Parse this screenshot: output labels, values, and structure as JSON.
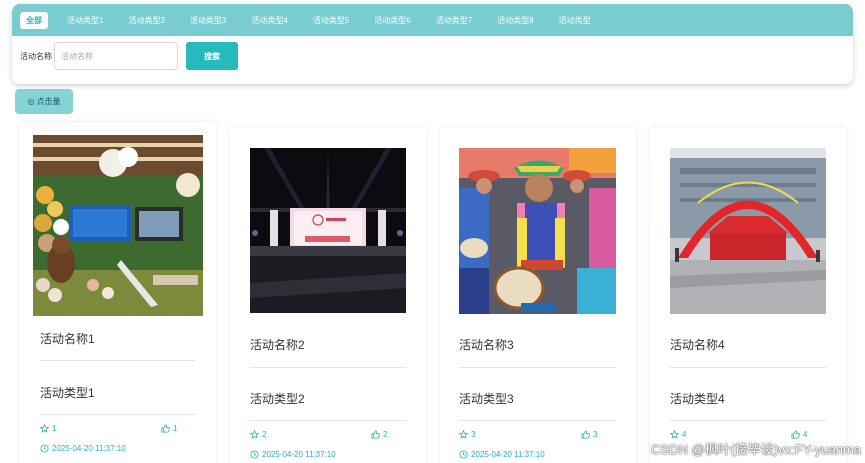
{
  "tabs": [
    {
      "label": "全部",
      "active": true
    },
    {
      "label": "活动类型1",
      "active": false
    },
    {
      "label": "活动类型2",
      "active": false
    },
    {
      "label": "活动类型3",
      "active": false
    },
    {
      "label": "活动类型4",
      "active": false
    },
    {
      "label": "活动类型5",
      "active": false
    },
    {
      "label": "活动类型6",
      "active": false
    },
    {
      "label": "活动类型7",
      "active": false
    },
    {
      "label": "活动类型8",
      "active": false
    },
    {
      "label": "活动类型",
      "active": false
    }
  ],
  "search": {
    "label": "活动名称",
    "placeholder": "活动名称",
    "value": "",
    "button_label": "搜索"
  },
  "sort": {
    "label": "点击量"
  },
  "cards": [
    {
      "name": "活动名称1",
      "type": "活动类型1",
      "views": "1",
      "likes": "1",
      "date": "2025-04-20 11:37:10",
      "image": "exhibition-hall-photo"
    },
    {
      "name": "活动名称2",
      "type": "活动类型2",
      "views": "2",
      "likes": "2",
      "date": "2025-04-20 11:37:10",
      "image": "stage-event-photo"
    },
    {
      "name": "活动名称3",
      "type": "活动类型3",
      "views": "3",
      "likes": "3",
      "date": "2025-04-20 11:37:10",
      "image": "drum-parade-photo"
    },
    {
      "name": "活动名称4",
      "type": "活动类型4",
      "views": "4",
      "likes": "4",
      "date": "",
      "image": "outdoor-arch-photo"
    }
  ],
  "watermark": "CSDN @枫叶(接毕设)vx:FY-yuanma",
  "colors": {
    "accent": "#26b9be",
    "tabbar": "#79cdd0",
    "sort_button": "#86d3d6",
    "meta_text": "#2ab3b8"
  }
}
